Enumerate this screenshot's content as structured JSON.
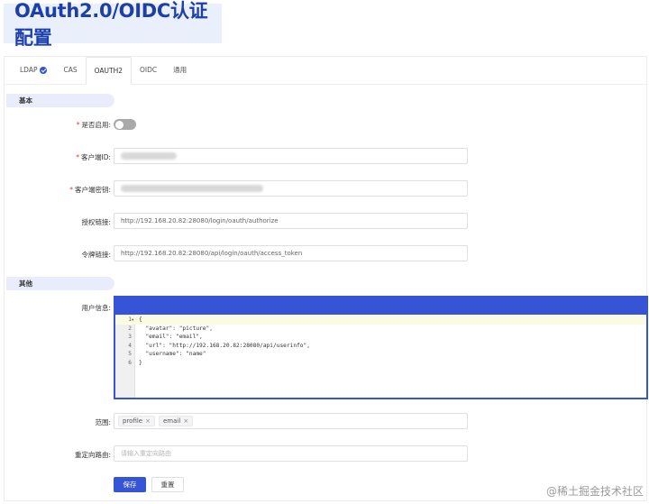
{
  "page_title": "OAuth2.0/OIDC认证配置",
  "tabs": [
    {
      "label": "LDAP",
      "checked": true
    },
    {
      "label": "CAS"
    },
    {
      "label": "OAUTH2",
      "active": true
    },
    {
      "label": "OIDC"
    },
    {
      "label": "通用"
    }
  ],
  "sections": {
    "basic": "基本",
    "other": "其他"
  },
  "form": {
    "enabled_label": "是否启用:",
    "enabled": false,
    "client_id_label": "客户端ID:",
    "client_secret_label": "客户端密钥:",
    "auth_url_label": "授权链接:",
    "auth_url": "http://192.168.20.82:28080/login/oauth/authorize",
    "token_url_label": "令牌链接:",
    "token_url": "http://192.168.20.82:28080/api/login/oauth/access_token",
    "user_info_label": "用户信息:",
    "scope_label": "范围:",
    "scopes": [
      "profile",
      "email"
    ],
    "redirect_label": "重定向路由:",
    "redirect_placeholder": "请输入重定向路由"
  },
  "editor": {
    "lines": [
      {
        "n": "1",
        "text": "{",
        "fold": "▼"
      },
      {
        "n": "2",
        "text": "  \"avatar\": \"picture\","
      },
      {
        "n": "3",
        "text": "  \"email\": \"email\","
      },
      {
        "n": "4",
        "text": "  \"url\": \"http://192.168.20.82:28080/api/userinfo\","
      },
      {
        "n": "5",
        "text": "  \"username\": \"name\""
      },
      {
        "n": "6",
        "text": "}"
      }
    ]
  },
  "buttons": {
    "save": "保存",
    "reset": "重置"
  },
  "watermark": "@稀土掘金技术社区",
  "colors": {
    "primary": "#3655d6",
    "title_text": "#1c3faa",
    "title_bg": "#e9f0fb",
    "required": "#e33333"
  }
}
